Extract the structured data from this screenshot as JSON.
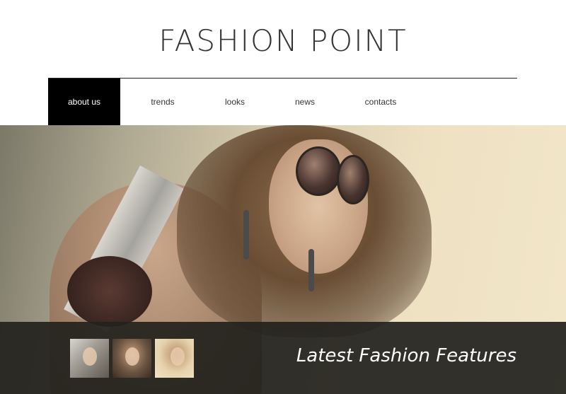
{
  "brand": {
    "title": "FASHION POINT"
  },
  "nav": {
    "items": [
      {
        "label": "about us",
        "active": true
      },
      {
        "label": "trends",
        "active": false
      },
      {
        "label": "looks",
        "active": false
      },
      {
        "label": "news",
        "active": false
      },
      {
        "label": "contacts",
        "active": false
      }
    ]
  },
  "hero": {
    "caption": "Latest Fashion Features",
    "thumbnails": [
      "thumbnail-1",
      "thumbnail-2",
      "thumbnail-3"
    ]
  },
  "colors": {
    "nav_active_bg": "#000000",
    "overlay_bg": "#24221e",
    "text_dark": "#333333"
  }
}
